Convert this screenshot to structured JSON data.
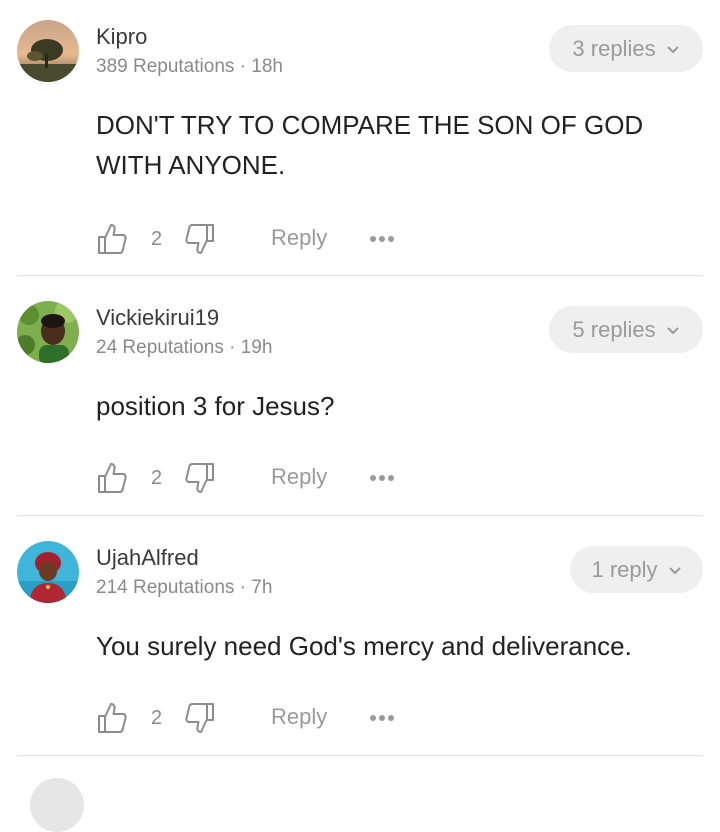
{
  "comments": [
    {
      "username": "Kipro",
      "reputation": "389 Reputations",
      "time": "18h",
      "replies": "3 replies",
      "text": "DON'T TRY TO COMPARE THE SON OF GOD WITH ANYONE.",
      "likes": "2",
      "reply_label": "Reply",
      "avatar_icon": "landscape-avatar"
    },
    {
      "username": "Vickiekirui19",
      "reputation": "24 Reputations",
      "time": "19h",
      "replies": "5 replies",
      "text": "position 3 for Jesus?",
      "likes": "2",
      "reply_label": "Reply",
      "avatar_icon": "portrait-avatar"
    },
    {
      "username": "UjahAlfred",
      "reputation": "214 Reputations",
      "time": "7h",
      "replies": "1 reply",
      "text": "You surely need God's mercy and deliverance.",
      "likes": "2",
      "reply_label": "Reply",
      "avatar_icon": "portrait-avatar"
    }
  ],
  "separator": " · "
}
